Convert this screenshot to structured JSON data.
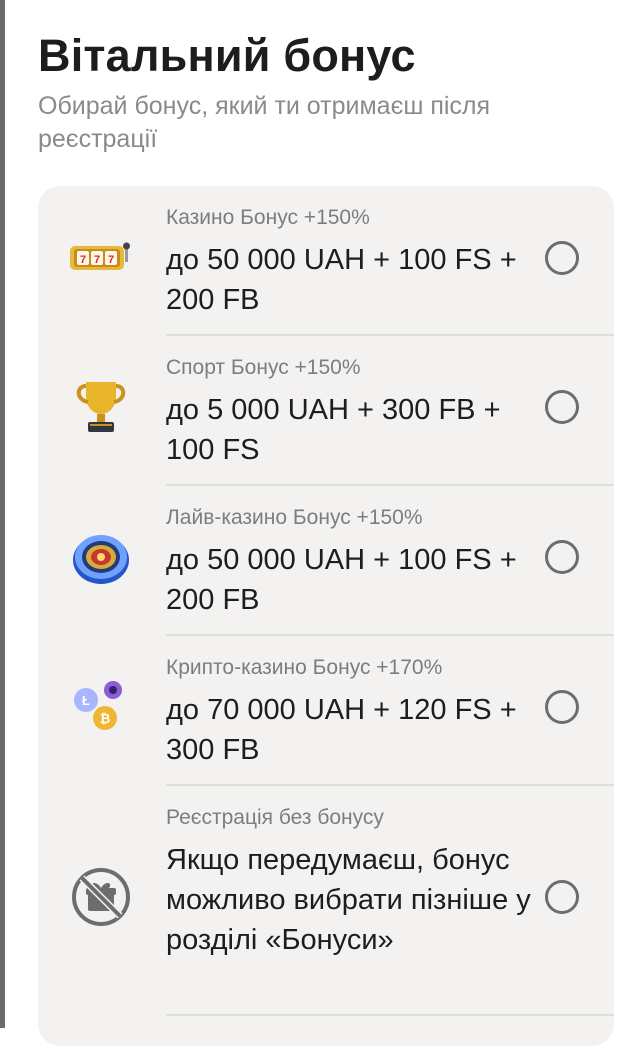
{
  "header": {
    "title": "Вітальний бонус",
    "subtitle": "Обирай бонус, який ти отримаєш після реєстрації"
  },
  "options": [
    {
      "label": "Казино Бонус +150%",
      "value": "до 50 000 UAH + 100 FS + 200 FB",
      "icon": "slot-machine-icon",
      "selected": false
    },
    {
      "label": "Спорт Бонус +150%",
      "value": "до 5 000 UAH + 300 FB + 100 FS",
      "icon": "trophy-icon",
      "selected": false
    },
    {
      "label": "Лайв-казино Бонус +150%",
      "value": "до 50 000 UAH + 100 FS + 200 FB",
      "icon": "roulette-icon",
      "selected": false
    },
    {
      "label": "Крипто-казино Бонус +170%",
      "value": "до 70 000 UAH + 120 FS + 300 FB",
      "icon": "crypto-coins-icon",
      "selected": false
    },
    {
      "label": "Реєстрація без бонусу",
      "value": "Якщо передумаєш, бонус можливо вибрати пізніше у розділі «Бонуси»",
      "icon": "no-gift-icon",
      "selected": false
    }
  ],
  "colors": {
    "card_background": "#f3f2f0",
    "title": "#1d1d1f",
    "subtitle": "#8a8a8e",
    "radio_border": "#6d6d70"
  }
}
